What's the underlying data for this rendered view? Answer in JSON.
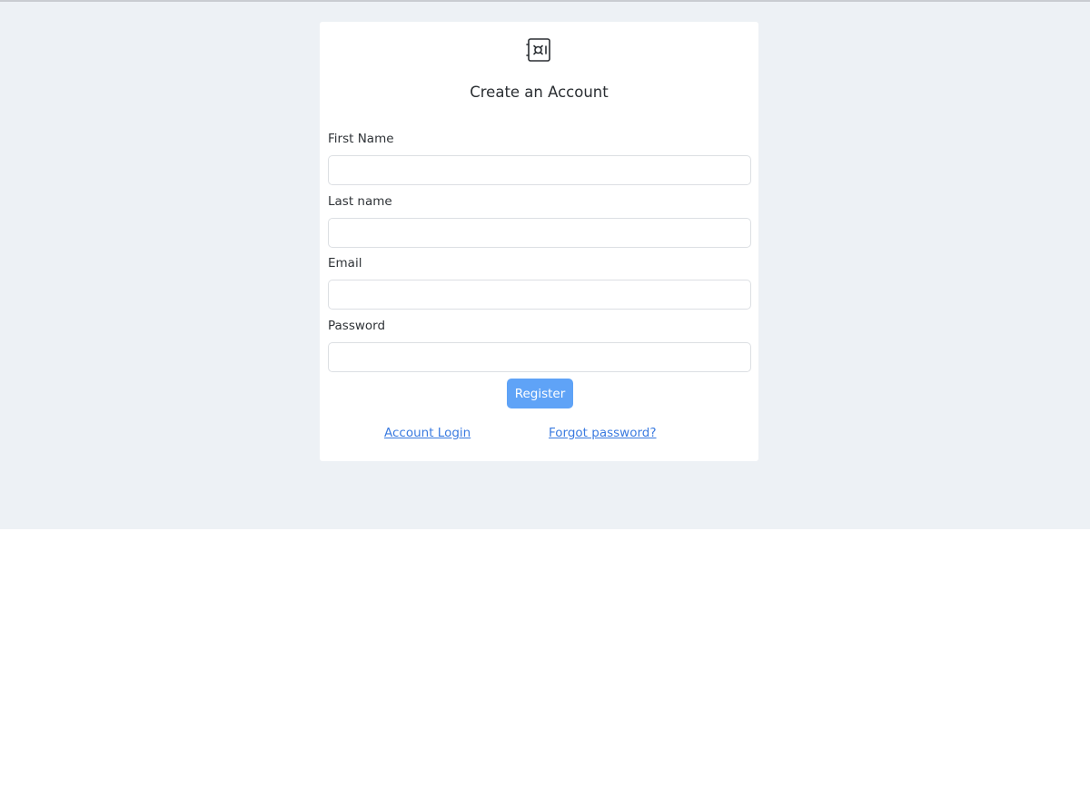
{
  "form": {
    "title": "Create an Account",
    "logo_icon": "safe-icon",
    "fields": [
      {
        "label": "First Name",
        "value": "",
        "placeholder": ""
      },
      {
        "label": "Last name",
        "value": "",
        "placeholder": ""
      },
      {
        "label": "Email",
        "value": "",
        "placeholder": ""
      },
      {
        "label": "Password",
        "value": "",
        "placeholder": ""
      }
    ],
    "register_label": "Register",
    "links": {
      "login": "Account Login",
      "forgot": "Forgot password?"
    }
  },
  "colors": {
    "background": "#edf1f5",
    "card": "#ffffff",
    "button": "#5fa3f7",
    "link": "#3b7be0"
  }
}
